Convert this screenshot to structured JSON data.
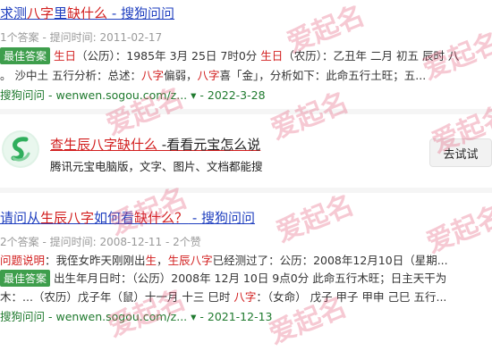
{
  "result1": {
    "title_pre": "求测",
    "title_hl1": "八字",
    "title_mid": "里",
    "title_hl2": "缺什么",
    "title_suffix": " - 搜狗问问",
    "meta": "1个答案 - 提问时间: 2011-02-17",
    "badge": "最佳答案",
    "line1_hl": "生日",
    "line1_a": "（公历）：1985年 3月 25日 7时0分 ",
    "line1_hl2": "生日",
    "line1_b": "（农历）：乙丑年 二月 初五 辰时 八",
    "line2_a": "。 沙中土 五行分析：总述：",
    "line2_hl": "八字",
    "line2_b": "偏弱，",
    "line2_hl2": "八字",
    "line2_c": "喜「金」，分析如下：此命五行土旺；五...",
    "source_name": "搜狗问问",
    "source_url": " - wenwen.sogou.com/z...",
    "source_arrow": " ▾",
    "source_date": " - 2022-3-28"
  },
  "ad": {
    "title_hl": "查生辰八字缺什么",
    "title_plain": " -看看元宝怎么说",
    "desc": "腾讯元宝电脑版，文字、图片、文档都能搜",
    "button": "去试试",
    "icon": "yuanbao-logo-icon"
  },
  "result2": {
    "title_pre": "请问从",
    "title_hl1": "生辰八字",
    "title_mid": "如何看",
    "title_hl2": "缺什么？",
    "title_suffix": " - 搜狗问问",
    "meta": "2个答案 - 提问时间: 2008-12-11 - 2个赞",
    "q_label": "问题说明",
    "q_a": "：我侄女昨天刚刚出",
    "q_hl": "生",
    "q_b": "，",
    "q_hl2": "生辰八字",
    "q_c": "已经测过了：公历：2008年12月10日（星期...",
    "badge": "最佳答案",
    "line1": "出生年月日时：（公历）2008年 12月 10日 9点0分 此命五行木旺；日主天干为",
    "line2_a": "木：...（农历）戊子年（鼠）十一月 十三 巳时 ",
    "line2_hl": "八字",
    "line2_b": "：（女命） 戊子 甲子 甲申 己巳 五行...",
    "source_name": "搜狗问问",
    "source_url": " - wenwen.sogou.com/z...",
    "source_arrow": " ▾",
    "source_date": " - 2021-12-13"
  },
  "watermark": "爱起名",
  "colors": {
    "link": "#1f3fbf",
    "highlight": "#d21f1f",
    "source": "#1f7a2e",
    "badge": "#3e9e4c",
    "watermark": "#e45876"
  }
}
